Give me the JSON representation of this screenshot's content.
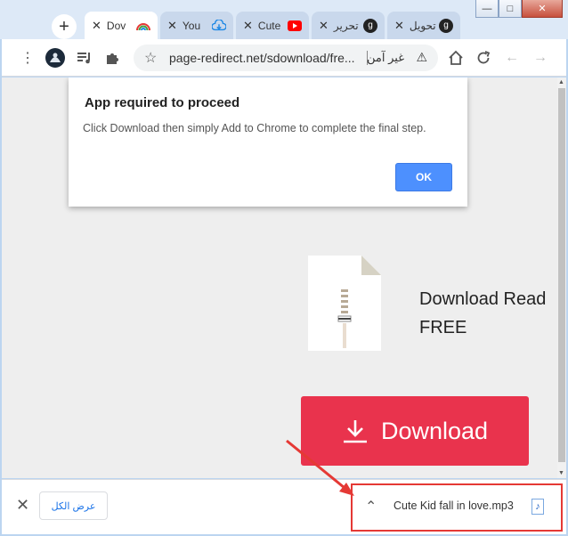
{
  "tabs": [
    {
      "label": "Dov",
      "favicon": "rainbow-icon",
      "active": true
    },
    {
      "label": "You",
      "favicon": "cloud-download-icon",
      "active": false
    },
    {
      "label": "Cute",
      "favicon": "youtube-icon",
      "active": false
    },
    {
      "label": "تحرير",
      "favicon": "g-icon",
      "active": false
    },
    {
      "label": "تحويل",
      "favicon": "g-icon",
      "active": false
    }
  ],
  "address_bar": {
    "url": "page-redirect.net/sdownload/fre...",
    "security_label": "غير آمن"
  },
  "dialog": {
    "title": "App required to proceed",
    "message": "Click Download then simply Add to Chrome to complete the final step.",
    "ok_label": "OK"
  },
  "page": {
    "heading_line1": "Download Read",
    "heading_line2": "FREE",
    "download_button_label": "Download"
  },
  "download_shelf": {
    "show_all_label": "عرض الكل",
    "file_name": "Cute Kid fall in love.mp3"
  },
  "colors": {
    "download_button": "#e9334d",
    "ok_button": "#4d90fe",
    "highlight_box": "#e53935"
  }
}
